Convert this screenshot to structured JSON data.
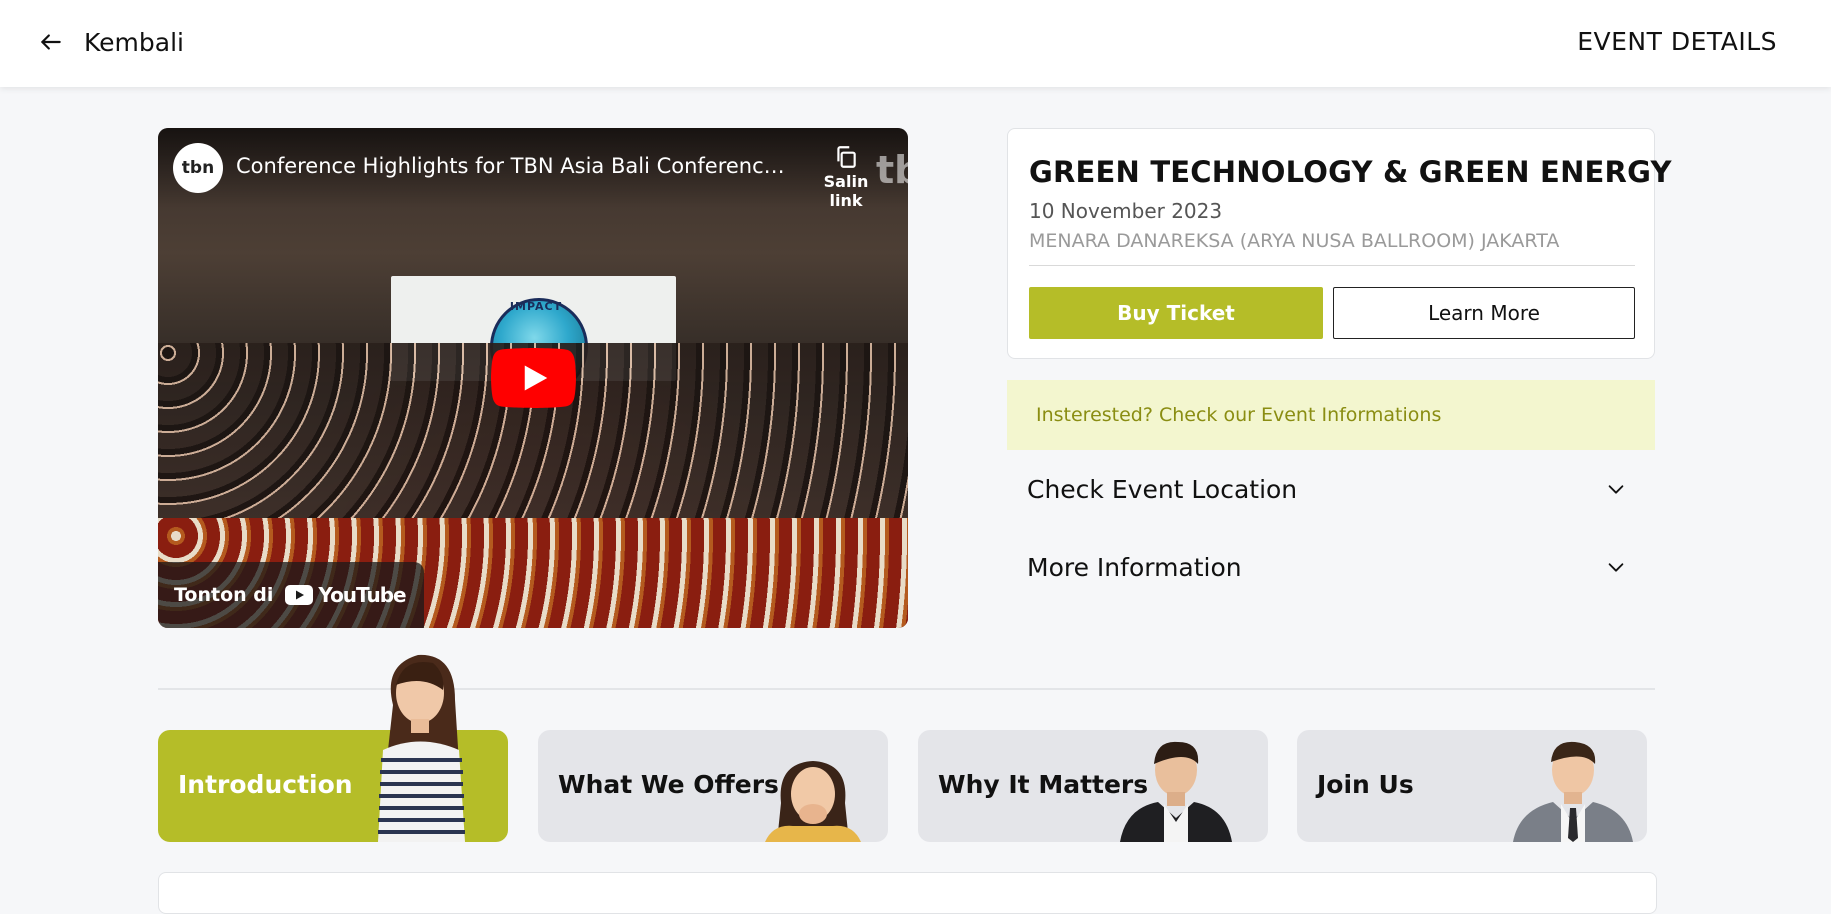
{
  "header": {
    "back_label": "Kembali",
    "page_title": "EVENT DETAILS"
  },
  "video": {
    "channel_logo": "tbn",
    "title": "Conference Highlights for TBN Asia Bali Conference 2...",
    "copy_link_label": "Salin link",
    "watermark": "tb",
    "banner_text": "IMPACT",
    "watch_on_label": "Tonton di",
    "youtube_label": "YouTube"
  },
  "event": {
    "title": "GREEN TECHNOLOGY & GREEN ENERGY",
    "date": "10 November 2023",
    "venue": "MENARA DANAREKSA (ARYA NUSA BALLROOM) JAKARTA",
    "buy_label": "Buy Ticket",
    "learn_label": "Learn More"
  },
  "info": {
    "banner": "Insterested? Check our Event Informations",
    "accordion": [
      {
        "label": "Check Event Location"
      },
      {
        "label": "More Information"
      }
    ]
  },
  "tabs": [
    {
      "label": "Introduction",
      "active": true
    },
    {
      "label": "What We Offers",
      "active": false
    },
    {
      "label": "Why It Matters",
      "active": false
    },
    {
      "label": "Join Us",
      "active": false
    }
  ],
  "colors": {
    "accent": "#b5bd28",
    "accent_light": "#f3f6cf",
    "accent_text": "#8a8d12",
    "tab_bg": "#e4e5e9",
    "youtube_red": "#ff0000"
  }
}
